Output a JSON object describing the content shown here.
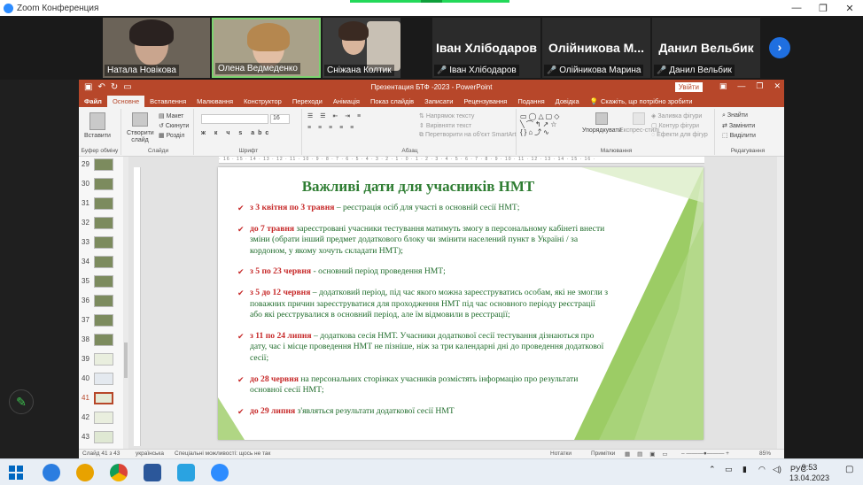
{
  "zoom": {
    "window_title": "Zoom Конференция",
    "participants": [
      {
        "name": "Натала Новікова",
        "video": true
      },
      {
        "name": "Олена Ведмеденко",
        "video": true,
        "active": true
      },
      {
        "name": "Сніжана Колтик",
        "video": true
      },
      {
        "name": "Іван Хлібодаров",
        "display": "Іван Хлібодаров",
        "muted": true
      },
      {
        "name": "Олійникова Марина",
        "display": "Олійникова М...",
        "muted": true
      },
      {
        "name": "Данил Вельбик",
        "display": "Данил Вельбик",
        "muted": true
      }
    ],
    "next_icon": "›"
  },
  "ppt": {
    "doc_title": "Презентация БТФ -2023  -  PowerPoint",
    "login": "Увійти",
    "tabs": [
      "Файл",
      "Основне",
      "Вставлення",
      "Малювання",
      "Конструктор",
      "Переходи",
      "Анімація",
      "Показ слайдів",
      "Записати",
      "Рецензування",
      "Подання",
      "Довідка"
    ],
    "active_tab": "Основне",
    "tell_me": "Скажіть, що потрібно зробити",
    "ribbon": {
      "clipboard_label": "Буфер обміну",
      "paste": "Вставити",
      "slides_label": "Слайди",
      "new_slide": "Створити слайд",
      "layout": "Макет",
      "reset": "Скинути",
      "section": "Розділ",
      "font_label": "Шрифт",
      "font_size": "16",
      "paragraph_label": "Абзац",
      "text_direction": "Напрямок тексту",
      "align_text": "Вирівняти текст",
      "smartart": "Перетворити на об'єкт SmartArt",
      "drawing_label": "Малювання",
      "arrange": "Упорядкувати",
      "quick_styles": "Експрес-стилі",
      "shape_fill": "Заливка фігури",
      "shape_outline": "Контур фігури",
      "shape_effects": "Ефекти для фігур",
      "editing_label": "Редагування",
      "find": "Знайти",
      "replace": "Замінити",
      "select": "Виділити"
    },
    "thumbnails": [
      "29",
      "30",
      "31",
      "32",
      "33",
      "34",
      "35",
      "36",
      "37",
      "38",
      "39",
      "40",
      "41",
      "42",
      "43"
    ],
    "selected_slide": "41",
    "slide": {
      "title": "Важливі дати для учасників НМТ",
      "bullets": [
        {
          "date": "з 3 квітня по 3 травня",
          "text": " – реєстрація осіб для участі в основній сесії НМТ;"
        },
        {
          "date": "до 7 травня",
          "text": " зареєстровані учасники тестування матимуть змогу в персональному кабінеті внести зміни (обрати інший предмет додаткового блоку чи змінити населений пункт в Україні / за кордоном, у якому хочуть складати НМТ);"
        },
        {
          "date": "з 5 по 23 червня",
          "text": " -  основний період проведення НМТ;"
        },
        {
          "date": "з 5 до 12 червня",
          "text": " – додатковий період, під час якого можна зареєструватись особам, які не змогли з поважних причин зареєструватися для проходження НМТ під час основного періоду реєстрації або які реєструвалися в основний період, але їм відмовили в реєстрації;"
        },
        {
          "date": "з 11 по 24 липня",
          "text": " – додаткова сесія НМТ. Учасники додаткової сесії тестування дізнаються про дату, час і місце проведення НМТ не пізніше, ніж за три календарні дні до проведення додаткової сесії;"
        },
        {
          "date": "до 28 червня",
          "text": " на персональних сторінках учасників розмістять інформацію про результати основної сесії НМТ;"
        },
        {
          "date": "до 29 липня",
          "text": " з'являться результати додаткової сесії НМТ"
        }
      ]
    },
    "status": {
      "slide_of": "Слайд 41 з 43",
      "language": "українська",
      "accessibility": "Спеціальні можливості: щось не так",
      "notes": "Нотатки",
      "comments": "Примітки",
      "zoom": "85%"
    }
  },
  "taskbar": {
    "lang": "РУС",
    "time": "9:53",
    "date": "13.04.2023"
  },
  "colors": {
    "ppt_red": "#b7472a",
    "slide_green": "#2e7d32",
    "date_red": "#c62828"
  }
}
